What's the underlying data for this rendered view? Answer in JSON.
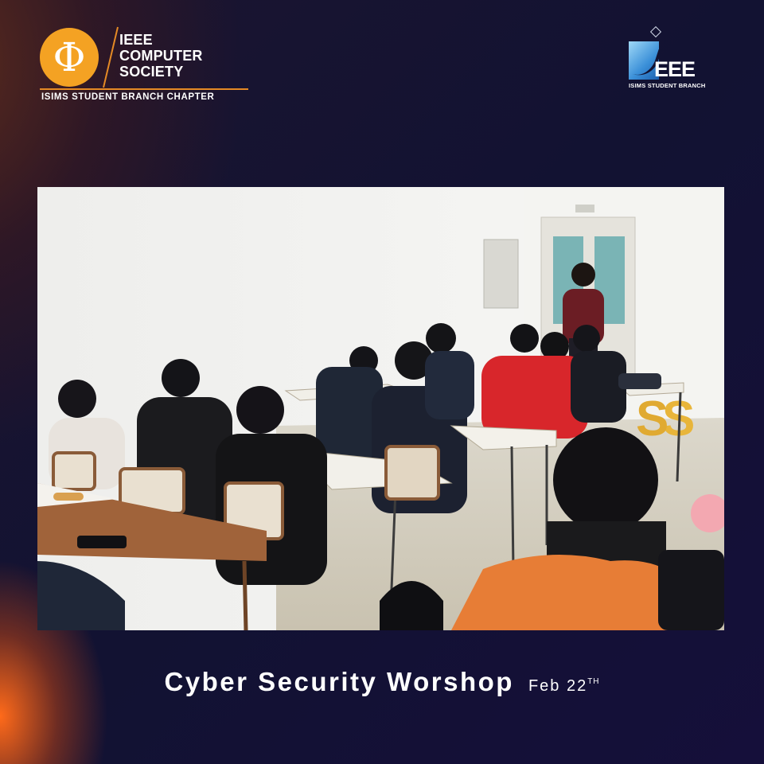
{
  "computer_society_logo": {
    "symbol": "Φ",
    "line1": "IEEE",
    "line2": "COMPUTER",
    "line3": "SOCIETY",
    "subtitle": "ISIMS STUDENT BRANCH CHAPTER",
    "accent_color": "#f4a223"
  },
  "ieee_logo": {
    "wordmark": "EEE",
    "subtitle": "ISIMS STUDENT BRANCH",
    "accent_color": "#3a8fd8"
  },
  "photo": {
    "icon": "classroom-photo"
  },
  "caption": {
    "title": "Cyber Security Worshop",
    "date": "Feb 22",
    "date_suffix": "TH"
  }
}
